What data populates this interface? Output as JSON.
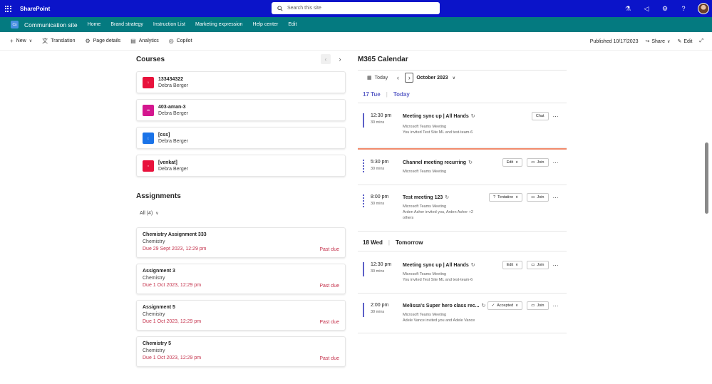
{
  "suitebar": {
    "app_name": "SharePoint",
    "search_placeholder": "Search this site"
  },
  "site": {
    "logo_text": "Cs",
    "title": "Communication site",
    "nav": [
      "Home",
      "Brand strategy",
      "Instruction List",
      "Marketing expression",
      "Help center",
      "Edit"
    ]
  },
  "commandbar": {
    "new": "New",
    "translation": "Translation",
    "page_details": "Page details",
    "analytics": "Analytics",
    "copilot": "Copilot",
    "published": "Published 10/17/2023",
    "share": "Share",
    "edit": "Edit"
  },
  "courses": {
    "title": "Courses",
    "items": [
      {
        "tile_text": "1",
        "name": "133434322",
        "owner": "Debra Berger",
        "color": "#e8123c"
      },
      {
        "tile_text": "4A",
        "name": "403-aman-3",
        "owner": "Debra Berger",
        "color": "#d4178f"
      },
      {
        "tile_text": "[",
        "name": "[css]",
        "owner": "Debra Berger",
        "color": "#1a73e8"
      },
      {
        "tile_text": "v",
        "name": "[venkat]",
        "owner": "Debra Berger",
        "color": "#e8123c"
      }
    ]
  },
  "assignments": {
    "title": "Assignments",
    "filter": "All (4)",
    "items": [
      {
        "title": "Chemistry Assignment 333",
        "course": "Chemistry",
        "due": "Due 29 Sept 2023, 12:29 pm",
        "status": "Past due"
      },
      {
        "title": "Assignment 3",
        "course": "Chemistry",
        "due": "Due 1 Oct 2023, 12:29 pm",
        "status": "Past due"
      },
      {
        "title": "Assignment 5",
        "course": "Chemistry",
        "due": "Due 1 Oct 2023, 12:29 pm",
        "status": "Past due"
      },
      {
        "title": "Chemistry 5",
        "course": "Chemistry",
        "due": "Due 1 Oct 2023, 12:29 pm",
        "status": "Past due"
      }
    ]
  },
  "calendar": {
    "title": "M365 Calendar",
    "today_button": "Today",
    "month": "October 2023",
    "day1": {
      "date": "17 Tue",
      "label": "Today"
    },
    "day2": {
      "date": "18 Wed",
      "label": "Tomorrow"
    },
    "events": [
      {
        "time": "12:30 pm",
        "duration": "30 mins",
        "title": "Meeting sync up | All Hands",
        "sub1": "Microsoft Teams Meeting",
        "sub2": "You invited Test Site ML and test-team-6",
        "action": "Chat"
      },
      {
        "time": "5:30 pm",
        "duration": "30 mins",
        "title": "Channel meeting recurring",
        "sub1": "Microsoft Teams Meeting",
        "sub2": "",
        "action": "Edit",
        "join": "Join"
      },
      {
        "time": "8:00 pm",
        "duration": "30 mins",
        "title": "Test meeting 123",
        "sub1": "Microsoft Teams Meeting",
        "sub2": "Arden Asher invited you, Arden Asher +2",
        "sub3": "others",
        "action": "Tentative",
        "join": "Join"
      },
      {
        "time": "12:30 pm",
        "duration": "30 mins",
        "title": "Meeting sync up | All Hands",
        "sub1": "Microsoft Teams Meeting",
        "sub2": "You invited Test Site ML and test-team-6",
        "action": "Edit",
        "join": "Join"
      },
      {
        "time": "2:00 pm",
        "duration": "30 mins",
        "title": "Melissa's Super hero class rec...",
        "sub1": "Microsoft Teams Meeting",
        "sub2": "Adele Vance invited you and Adele Vance",
        "action": "Accepted",
        "join": "Join"
      }
    ]
  }
}
